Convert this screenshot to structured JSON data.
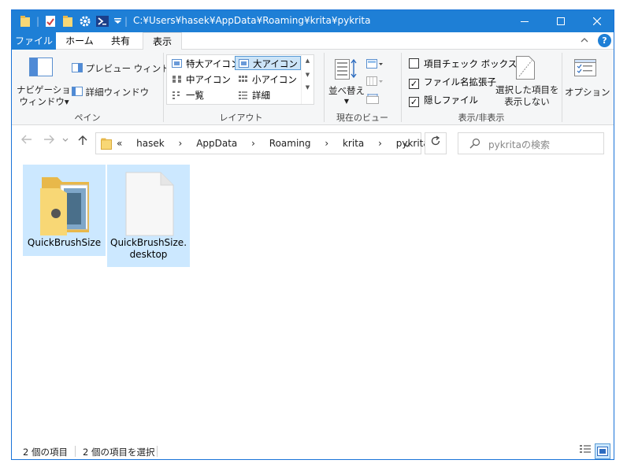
{
  "window": {
    "title": "C:¥Users¥hasek¥AppData¥Roaming¥krita¥pykrita",
    "controls": [
      "minimize",
      "maximize",
      "close"
    ]
  },
  "ribbon_tabs": [
    {
      "label": "ファイル",
      "state": "file"
    },
    {
      "label": "ホーム",
      "state": "normal"
    },
    {
      "label": "共有",
      "state": "normal"
    },
    {
      "label": "表示",
      "state": "active"
    }
  ],
  "ribbon": {
    "pane": {
      "nav_pane": "ナビゲーション\nウィンドウ ▾",
      "nav_pane_line1": "ナビゲーション",
      "nav_pane_line2": "ウィンドウ▾",
      "preview_pane": "プレビュー ウィンドウ",
      "details_pane": "詳細ウィンドウ",
      "label": "ペイン"
    },
    "layout": {
      "options": [
        "特大アイコン",
        "大アイコン",
        "中アイコン",
        "小アイコン",
        "一覧",
        "詳細"
      ],
      "selected": "大アイコン",
      "label": "レイアウト"
    },
    "current_view": {
      "sort_by": "並べ替え",
      "label": "現在のビュー"
    },
    "show_hide": {
      "item_checkboxes": "項目チェック ボックス",
      "item_checkboxes_checked": false,
      "file_extensions": "ファイル名拡張子",
      "file_extensions_checked": true,
      "hidden_items": "隠しファイル",
      "hidden_items_checked": true,
      "hide_selected_line1": "選択した項目を",
      "hide_selected_line2": "表示しない",
      "label": "表示/非表示"
    },
    "options": "オプション"
  },
  "address": {
    "crumbs": [
      "«",
      "hasek",
      "AppData",
      "Roaming",
      "krita",
      "pykrita"
    ],
    "search_placeholder": "pykritaの検索"
  },
  "files": [
    {
      "name": "QuickBrushSize",
      "type": "folder",
      "selected": true
    },
    {
      "name": "QuickBrushSize.desktop",
      "type": "file",
      "selected": true
    }
  ],
  "status": {
    "item_count": "2 個の項目",
    "selected_count": "2 個の項目を選択"
  },
  "colors": {
    "accent": "#1e7fd6",
    "selection": "#cce8ff"
  }
}
